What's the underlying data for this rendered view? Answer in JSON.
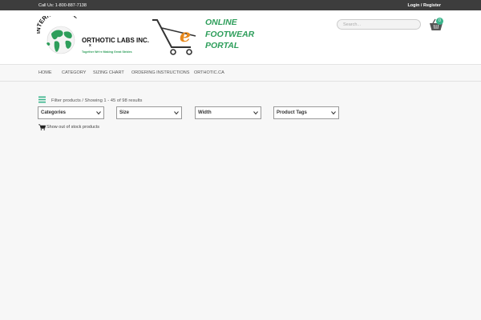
{
  "topbar": {
    "call_text": "Call Us: 1-800-887-7138",
    "login_text": "Login / Register"
  },
  "logo_ortho": {
    "line1": "INTERNATIONAL",
    "line2": "ORTHOTIC LABS INC.",
    "tagline": "Together We're Making Great Strides"
  },
  "logo_efootwear": {
    "letter": "e",
    "line1": "ONLINE",
    "line2": "FOOTWEAR",
    "line3": "PORTAL"
  },
  "search": {
    "placeholder": "Search..."
  },
  "cart": {
    "count": "0"
  },
  "nav": {
    "items": [
      "HOME",
      "CATEGORY",
      "SIZING CHART",
      "ORDERING INSTRUCTIONS",
      "ORTHOTIC.CA"
    ]
  },
  "filter": {
    "text": "Filter products / Showing 1 - 45 of 98 results",
    "selects": [
      "Categories",
      "Size",
      "Width",
      "Product Tags"
    ],
    "stock_text": "Show out of stock products"
  },
  "colors": {
    "accent": "#3bb58c",
    "brand_green": "#2e9e5b",
    "orange": "#e8891c",
    "topbar": "#3d3d3d"
  }
}
